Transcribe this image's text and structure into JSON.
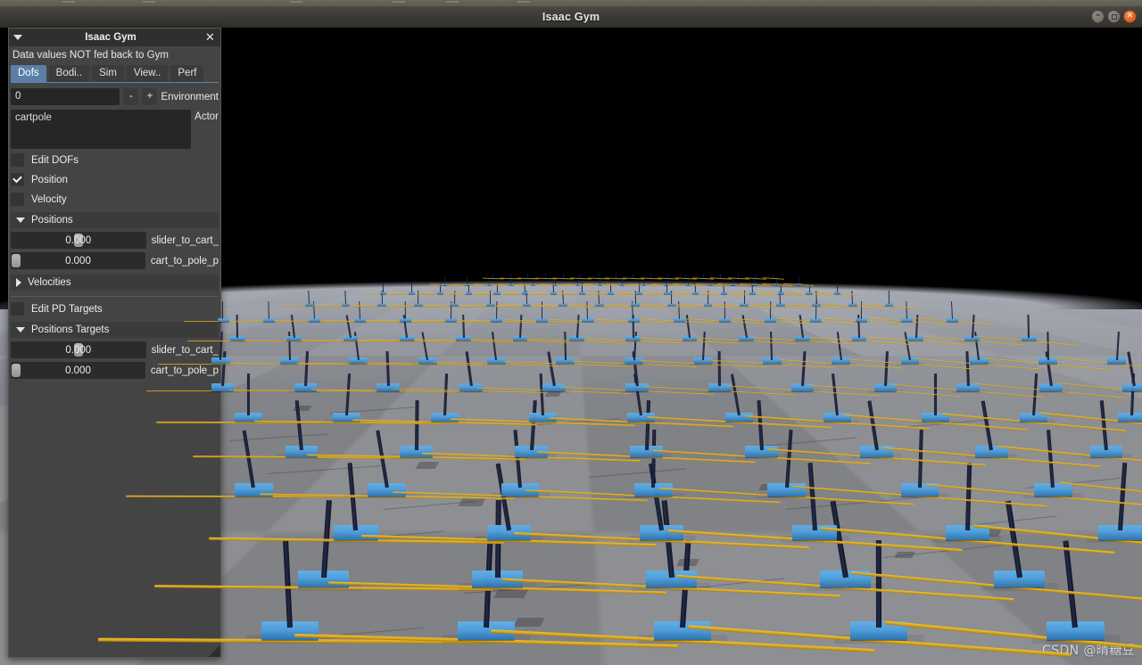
{
  "window": {
    "title": "Isaac Gym",
    "controls": {
      "minimize": "minimize-button",
      "maximize": "maximize-button",
      "close": "close-button"
    }
  },
  "panel": {
    "title": "Isaac Gym",
    "collapse_icon": "triangle-down-icon",
    "close_icon": "close-icon",
    "note": "Data values NOT fed back to Gym",
    "tabs": [
      {
        "label": "Dofs",
        "active": true
      },
      {
        "label": "Bodi..",
        "active": false
      },
      {
        "label": "Sim",
        "active": false
      },
      {
        "label": "View..",
        "active": false
      },
      {
        "label": "Perf",
        "active": false
      }
    ],
    "environment": {
      "value": "0",
      "decrement_label": "-",
      "increment_label": "+",
      "label": "Environment"
    },
    "actor": {
      "selected": "cartpole",
      "label": "Actor"
    },
    "checkboxes": [
      {
        "label": "Edit DOFs",
        "checked": false
      },
      {
        "label": "Position",
        "checked": true
      },
      {
        "label": "Velocity",
        "checked": false
      }
    ],
    "sections": [
      {
        "name": "positions",
        "header": "Positions",
        "expanded": true,
        "sliders": [
          {
            "value": "0.000",
            "label": "slider_to_cart_",
            "handle_pct": 50
          },
          {
            "value": "0.000",
            "label": "cart_to_pole_p",
            "handle_pct": 0
          }
        ]
      },
      {
        "name": "velocities",
        "header": "Velocities",
        "expanded": false,
        "sliders": []
      }
    ],
    "pd": {
      "checkbox": {
        "label": "Edit PD Targets",
        "checked": false
      },
      "header": "Positions Targets",
      "expanded": true,
      "sliders": [
        {
          "value": "0.000",
          "label": "slider_to_cart_",
          "handle_pct": 50
        },
        {
          "value": "0.000",
          "label": "cart_to_pole_p",
          "handle_pct": 0
        }
      ]
    }
  },
  "viewport": {
    "name": "isaac-gym-3d-viewport",
    "sky_color": "#000000",
    "ground_color": "#8d8f93",
    "rail_color": "#d9a51b",
    "cart_color": "#4f9fdc",
    "pole_color": "#1a1f38"
  },
  "watermark": {
    "text": "CSDN @晴糖豆"
  }
}
